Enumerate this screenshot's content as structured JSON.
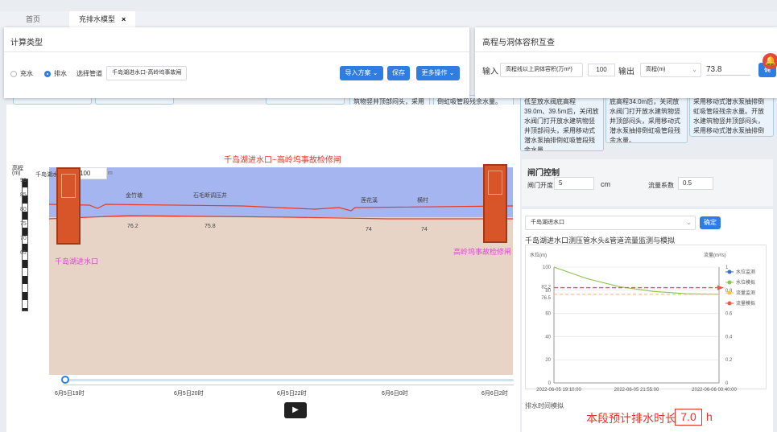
{
  "tabs": [
    {
      "label": "首页"
    },
    {
      "label": "充排水模型",
      "close": "×"
    }
  ],
  "calc_panel": {
    "title": "计算类型",
    "radio_fill": "充水",
    "radio_drain": "排水",
    "pipe_label": "选择管道",
    "pipe_value": "千岛湖进水口-高岭坞事故闸",
    "import_btn": "导入方案",
    "save_btn": "保存",
    "more_btn": "更多操作"
  },
  "conv_panel": {
    "title": "高程与洞体容积互查",
    "input_label": "输入",
    "input_select": "高程线以上洞体容积(万m³)",
    "input_value": "100",
    "output_label": "输出",
    "output_select": "高程(m)",
    "output_value": "73.8",
    "confirm": "确"
  },
  "notes": [
    "筑物竖井顶部闷头，采用移动式潜水泵抽排倒虹吸管段残余水量。",
    "倒虹吸管段残余水量。",
    "低至放水阀底高程39.0m、39.5m后，关闭放水阀门打开放水建筑物竖井顶部闷头，采用移动式潜水泵抽排倒虹吸管段残余水量。",
    "底高程34.0m后，关闭放水阀门打开放水建筑物竖井顶部闷头，采用移动式潜水泵抽排倒虹吸管段残余水量。",
    "采用移动式潜水泵抽排倒虹吸管段残余水量。开放水建筑物竖井顶部闷头，采用移动式潜水泵抽排倒虹吸管段残余水量。"
  ],
  "profile": {
    "title": "千岛湖进水口~高岭坞事故检修闸",
    "elev_label": "高程",
    "elev_unit": "(m)",
    "water_label": "千岛湖水位",
    "water_value": "100",
    "water_unit": "m",
    "y_ticks": [
      "90",
      "85",
      "80",
      "75",
      "70",
      "65"
    ],
    "left_station": "千岛湖进水口",
    "right_station": "高岭坞事故检修闸",
    "points": [
      {
        "name": "金竹塘",
        "value": "76.2"
      },
      {
        "name": "石毛断调压井",
        "value": "75.8"
      },
      {
        "name": "莲花溪",
        "value": "74"
      },
      {
        "name": "横村",
        "value": "74"
      }
    ],
    "time_ticks": [
      "6月5日19时",
      "6月5日20时",
      "6月5日22时",
      "6月6日0时",
      "6月6日2时"
    ]
  },
  "gate_control": {
    "title": "闸门控制",
    "opening_label": "闸门开度",
    "opening_value": "5",
    "opening_unit": "cm",
    "coef_label": "流量系数",
    "coef_value": "0.5"
  },
  "monitor": {
    "select_value": "千岛湖进水口",
    "confirm_btn": "确定",
    "title": "千岛湖进水口测压管水头&管道流量监测与模拟",
    "footer": "排水时间模拟"
  },
  "chart_data": {
    "type": "line",
    "ylabel": "水位(m)",
    "y2label": "流量(m³/s)",
    "ylim": [
      0,
      100
    ],
    "y2lim": [
      0,
      1
    ],
    "y_ticks": [
      "100",
      "80",
      "60",
      "40",
      "20",
      "0"
    ],
    "y_marks": [
      "82.2",
      "76.5"
    ],
    "y2_ticks": [
      "1",
      "0.8",
      "0.6",
      "0.4",
      "0.2",
      "0"
    ],
    "x_ticks": [
      "2022-06-05 19:10:00",
      "2022-06-05 21:55:00",
      "2022-06-06 00:40:00"
    ],
    "series": [
      {
        "name": "水位监测",
        "color": "#3a6fc8",
        "values": []
      },
      {
        "name": "水位模拟",
        "color": "#8bc34a",
        "values": [
          100,
          90,
          83,
          79,
          77,
          76.5
        ]
      },
      {
        "name": "流量监测",
        "color": "#f6c244",
        "values": [
          76.5,
          76.5,
          76.5,
          76.5,
          76.5,
          76.5
        ]
      },
      {
        "name": "流量模拟",
        "color": "#e6584a",
        "values": [
          82.2,
          82.2,
          82.2,
          82.2,
          82.2,
          82.2
        ]
      }
    ]
  },
  "estimate": {
    "label": "本段预计排水时长",
    "value": "7.0",
    "unit": "h"
  }
}
